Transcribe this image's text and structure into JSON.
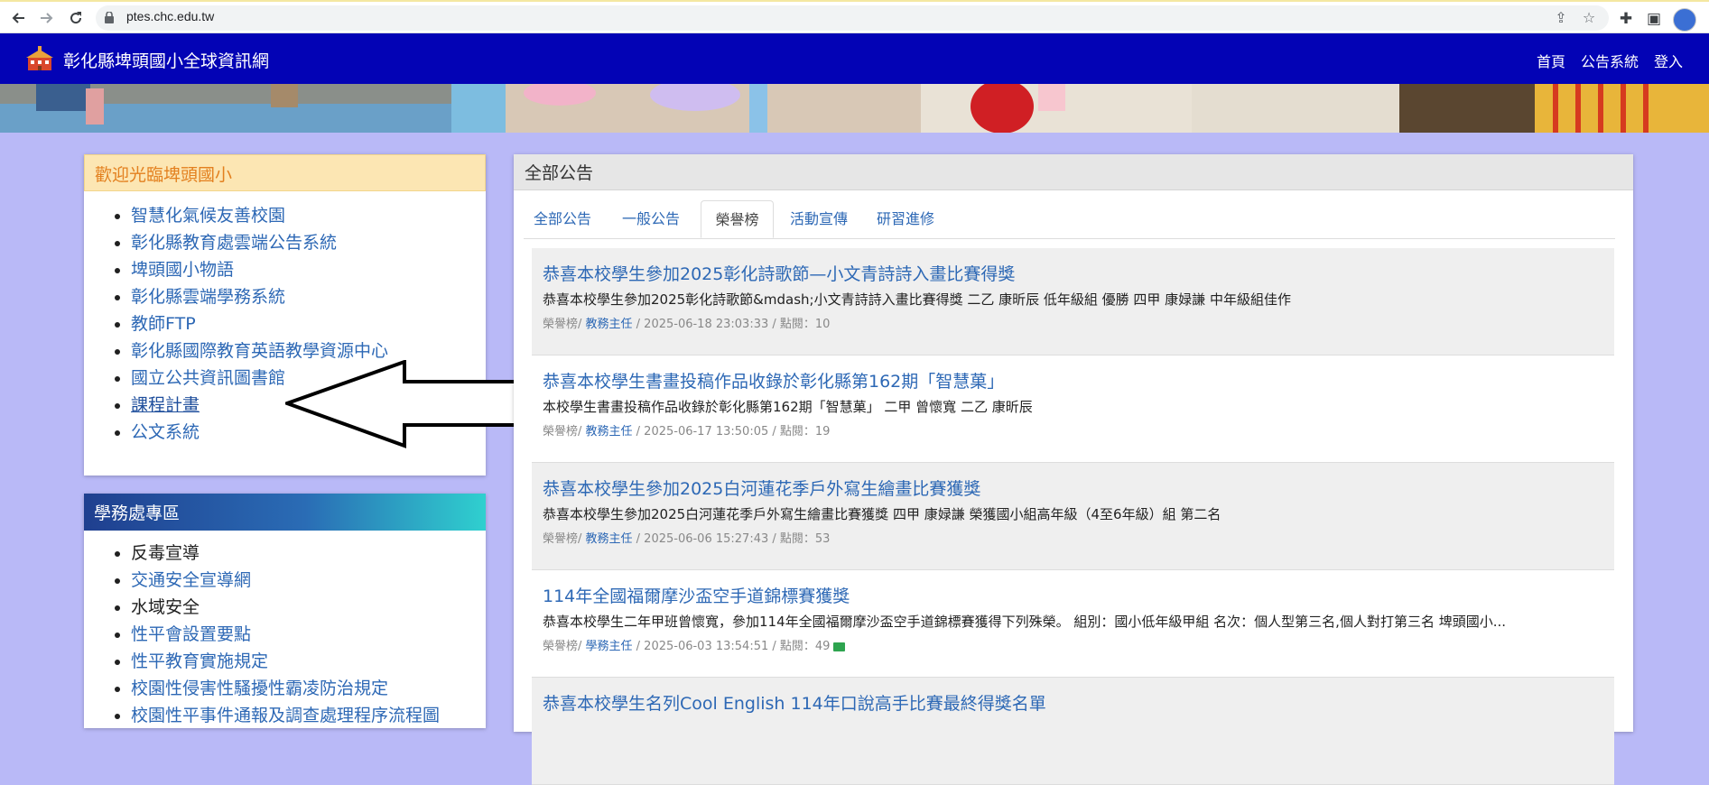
{
  "browser": {
    "url": "ptes.chc.edu.tw",
    "back_icon": "arrow-left-icon",
    "forward_icon": "arrow-right-icon",
    "reload_icon": "reload-icon"
  },
  "site": {
    "title": "彰化縣埤頭國小全球資訊網",
    "nav": [
      "首頁",
      "公告系統",
      "登入"
    ]
  },
  "welcome_panel": {
    "heading": "歡迎光臨埤頭國小",
    "links": [
      "智慧化氣候友善校園",
      "彰化縣教育處雲端公告系統",
      "埤頭國小物語",
      "彰化縣雲端學務系統",
      "教師FTP",
      "彰化縣國際教育英語教學資源中心",
      "國立公共資訊圖書館",
      "課程計畫",
      "公文系統"
    ]
  },
  "student_affairs_panel": {
    "heading": "學務處專區",
    "links": [
      "反毒宣導",
      "交通安全宣導網",
      "水域安全",
      "性平會設置要點",
      "性平教育實施規定",
      "校園性侵害性騷擾性霸凌防治規定",
      "校園性平事件通報及調查處理程序流程圖"
    ]
  },
  "announcements": {
    "heading": "全部公告",
    "tabs": [
      "全部公告",
      "一般公告",
      "榮譽榜",
      "活動宣傳",
      "研習進修"
    ],
    "active_tab": "榮譽榜",
    "items": [
      {
        "title": "恭喜本校學生參加2025彰化詩歌節—小文青詩詩入畫比賽得獎",
        "summary": "恭喜本校學生參加2025彰化詩歌節&mdash;小文青詩詩入畫比賽得獎 二乙 康昕辰 低年級組 優勝 四甲 康娽謙 中年級組佳作",
        "category": "榮譽榜/ ",
        "author": "教務主任",
        "meta": " / 2025-06-18 23:03:33 / 點閱：10"
      },
      {
        "title": "恭喜本校學生書畫投稿作品收錄於彰化縣第162期「智慧菓」",
        "summary": "本校學生書畫投稿作品收錄於彰化縣第162期「智慧菓」 二甲 曾懷寬 二乙 康昕辰",
        "category": "榮譽榜/ ",
        "author": "教務主任",
        "meta": " / 2025-06-17 13:50:05 / 點閱：19"
      },
      {
        "title": "恭喜本校學生參加2025白河蓮花季戶外寫生繪畫比賽獲獎",
        "summary": "恭喜本校學生參加2025白河蓮花季戶外寫生繪畫比賽獲獎 四甲 康娽謙 榮獲國小組高年級（4至6年級）組 第二名",
        "category": "榮譽榜/ ",
        "author": "教務主任",
        "meta": " / 2025-06-06 15:27:43 / 點閱：53"
      },
      {
        "title": "114年全國福爾摩沙盃空手道錦標賽獲獎",
        "summary": "恭喜本校學生二年甲班曾懷寬，參加114年全國福爾摩沙盃空手道錦標賽獲得下列殊榮。 組別：國小低年級甲組 名次：個人型第三名,個人對打第三名 埤頭國小...",
        "category": "榮譽榜/ ",
        "author": "學務主任",
        "meta": " / 2025-06-03 13:54:51 / 點閱：49",
        "has_image": true
      },
      {
        "title": "恭喜本校學生名列Cool English 114年口說高手比賽最終得獎名單",
        "summary": "",
        "category": "",
        "author": "",
        "meta": ""
      }
    ]
  }
}
